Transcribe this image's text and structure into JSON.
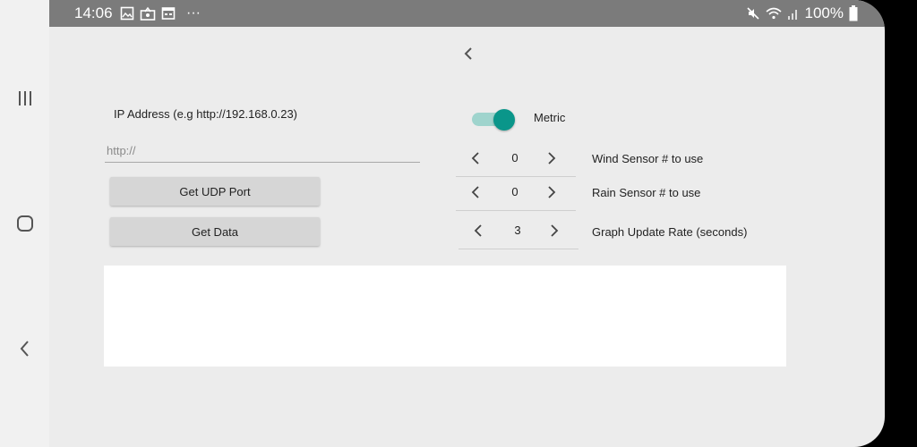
{
  "status_bar": {
    "time": "14:06",
    "left_icons": [
      "gallery-icon",
      "photo-upload-icon",
      "calendar-icon",
      "more-dots-icon"
    ],
    "right_icons": [
      "mute-icon",
      "wifi-icon",
      "signal-icon",
      "battery-icon"
    ],
    "battery": "100%",
    "more": "···"
  },
  "nav": {
    "back_icon": "chevron-left-icon"
  },
  "form": {
    "ip_label": "IP Address (e.g http://192.168.0.23)",
    "ip_placeholder": "http://",
    "ip_value": "",
    "get_udp_port_label": "Get UDP Port",
    "get_data_label": "Get Data"
  },
  "settings": {
    "metric_label": "Metric",
    "metric_enabled": true,
    "accent_color": "#0a968a",
    "steppers": [
      {
        "value": "0",
        "label": "Wind Sensor # to use"
      },
      {
        "value": "0",
        "label": "Rain Sensor # to use"
      },
      {
        "value": "3",
        "label": "Graph Update Rate (seconds)"
      }
    ]
  }
}
